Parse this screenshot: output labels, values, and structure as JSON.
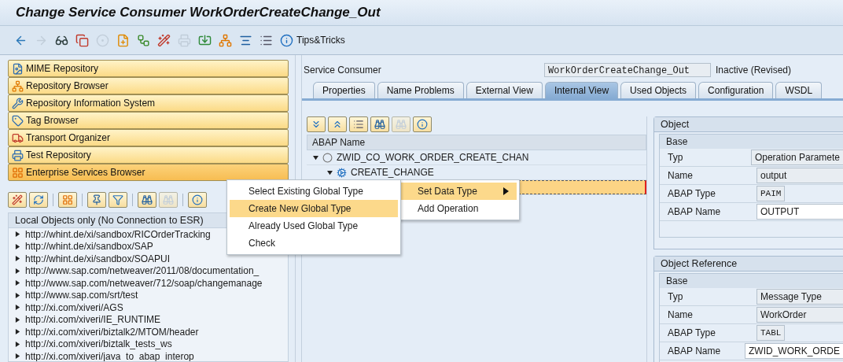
{
  "window": {
    "title": "Change Service Consumer WorkOrderCreateChange_Out"
  },
  "toolbar": {
    "items": [
      {
        "kind": "back",
        "disabled": false
      },
      {
        "kind": "forward",
        "disabled": true
      },
      {
        "kind": "display-change",
        "disabled": false
      },
      {
        "kind": "copy",
        "disabled": false
      },
      {
        "kind": "circles",
        "disabled": true
      },
      {
        "kind": "new-object",
        "disabled": false
      },
      {
        "kind": "nodes",
        "disabled": false
      },
      {
        "kind": "wand",
        "disabled": false
      },
      {
        "kind": "test",
        "disabled": true
      },
      {
        "kind": "import",
        "disabled": false
      },
      {
        "kind": "hierarchy",
        "disabled": false
      },
      {
        "kind": "stack",
        "disabled": false
      },
      {
        "kind": "list",
        "disabled": false
      }
    ],
    "tips": {
      "label": "Tips&Tricks"
    }
  },
  "navigator": {
    "buttons": [
      {
        "label": "MIME Repository",
        "kind": "mime",
        "selected": false
      },
      {
        "label": "Repository Browser",
        "kind": "hierarchy",
        "selected": false
      },
      {
        "label": "Repository Information System",
        "kind": "tool",
        "selected": false
      },
      {
        "label": "Tag Browser",
        "kind": "tag",
        "selected": false
      },
      {
        "label": "Transport Organizer",
        "kind": "truck",
        "selected": false
      },
      {
        "label": "Test Repository",
        "kind": "test",
        "selected": false
      },
      {
        "label": "Enterprise Services Browser",
        "kind": "squares",
        "selected": true
      }
    ]
  },
  "object_toolbar": {
    "items": [
      {
        "kind": "wand",
        "disabled": false
      },
      {
        "kind": "refresh",
        "disabled": false
      },
      {
        "kind": "separator"
      },
      {
        "kind": "squares",
        "disabled": false
      },
      {
        "kind": "separator"
      },
      {
        "kind": "pin",
        "disabled": false
      },
      {
        "kind": "filter",
        "disabled": false
      },
      {
        "kind": "separator"
      },
      {
        "kind": "binoculars",
        "disabled": false
      },
      {
        "kind": "binoculars-plus",
        "disabled": true
      },
      {
        "kind": "separator"
      },
      {
        "kind": "info",
        "disabled": false
      }
    ]
  },
  "object_list": {
    "header": "Local Objects only (No Connection to ESR)",
    "items": [
      {
        "label": "http://whint.de/xi/sandbox/RICOrderTracking",
        "expanded": false
      },
      {
        "label": "http://whint.de/xi/sandbox/SAP",
        "expanded": false
      },
      {
        "label": "http://whint.de/xi/sandbox/SOAPUI",
        "expanded": false
      },
      {
        "label": "http://www.sap.com/netweaver/2011/08/documentation_",
        "expanded": false
      },
      {
        "label": "http://www.sap.com/netweaver/712/soap/changemanage",
        "expanded": false
      },
      {
        "label": "http://www.sap.com/srt/test",
        "expanded": false
      },
      {
        "label": "http://xi.com/xiveri/AGS",
        "expanded": false
      },
      {
        "label": "http://xi.com/xiveri/IE_RUNTIME",
        "expanded": false
      },
      {
        "label": "http://xi.com/xiveri/biztalk2/MTOM/header",
        "expanded": false
      },
      {
        "label": "http://xi.com/xiveri/biztalk_tests_ws",
        "expanded": false
      },
      {
        "label": "http://xi.com/xiveri/java_to_abap_interop",
        "expanded": false
      }
    ]
  },
  "header": {
    "label": "Service Consumer",
    "value": "WorkOrderCreateChange_Out",
    "status": "Inactive (Revised)"
  },
  "tabs": [
    {
      "label": "Properties",
      "selected": false
    },
    {
      "label": "Name Problems",
      "selected": false
    },
    {
      "label": "External View",
      "selected": false
    },
    {
      "label": "Internal View",
      "selected": true
    },
    {
      "label": "Used Objects",
      "selected": false
    },
    {
      "label": "Configuration",
      "selected": false
    },
    {
      "label": "WSDL",
      "selected": false
    }
  ],
  "tree_toolbar": {
    "items": [
      {
        "kind": "expand",
        "disabled": false
      },
      {
        "kind": "collapse",
        "disabled": false
      },
      {
        "kind": "list",
        "disabled": false
      },
      {
        "kind": "binoculars",
        "disabled": false
      },
      {
        "kind": "binoculars-plus",
        "disabled": true
      },
      {
        "kind": "info",
        "disabled": false
      }
    ]
  },
  "tree": {
    "column": "ABAP Name",
    "nodes": [
      {
        "label": "ZWID_CO_WORK_ORDER_CREATE_CHAN",
        "kind": "interface",
        "expanded": true,
        "selected": false,
        "children": [
          {
            "label": "CREATE_CHANGE",
            "kind": "operation",
            "expanded": true,
            "selected": false,
            "children": [
              {
                "kind": "parameter",
                "selected": true
              }
            ]
          }
        ]
      }
    ]
  },
  "context_menu": {
    "items": [
      {
        "label": "Set Data Type",
        "submenu": true,
        "selected": true
      },
      {
        "label": "Add Operation",
        "submenu": false,
        "selected": false
      }
    ]
  },
  "submenu": {
    "items": [
      {
        "label": "Select Existing Global Type",
        "selected": false
      },
      {
        "label": "Create New Global Type",
        "selected": true
      },
      {
        "label": "Already Used Global Type",
        "selected": false
      },
      {
        "label": "Check",
        "selected": false
      }
    ]
  },
  "object_panel": {
    "groups": [
      {
        "title": "Object",
        "section": "Base",
        "fields": [
          {
            "label": "Typ",
            "value": "Operation Paramete",
            "kind": "display"
          },
          {
            "label": "Name",
            "value": "output",
            "kind": "display"
          },
          {
            "label": "ABAP Type",
            "value": "PAIM",
            "kind": "code"
          },
          {
            "label": "ABAP Name",
            "value": "OUTPUT",
            "kind": "input"
          }
        ]
      },
      {
        "title": "Object Reference",
        "section": "Base",
        "fields": [
          {
            "label": "Typ",
            "value": "Message Type",
            "kind": "display"
          },
          {
            "label": "Name",
            "value": "WorkOrder",
            "kind": "display"
          },
          {
            "label": "ABAP Type",
            "value": "TABL",
            "kind": "code"
          },
          {
            "label": "ABAP Name",
            "value": "ZWID_WORK_ORDE",
            "kind": "input"
          }
        ]
      }
    ]
  }
}
